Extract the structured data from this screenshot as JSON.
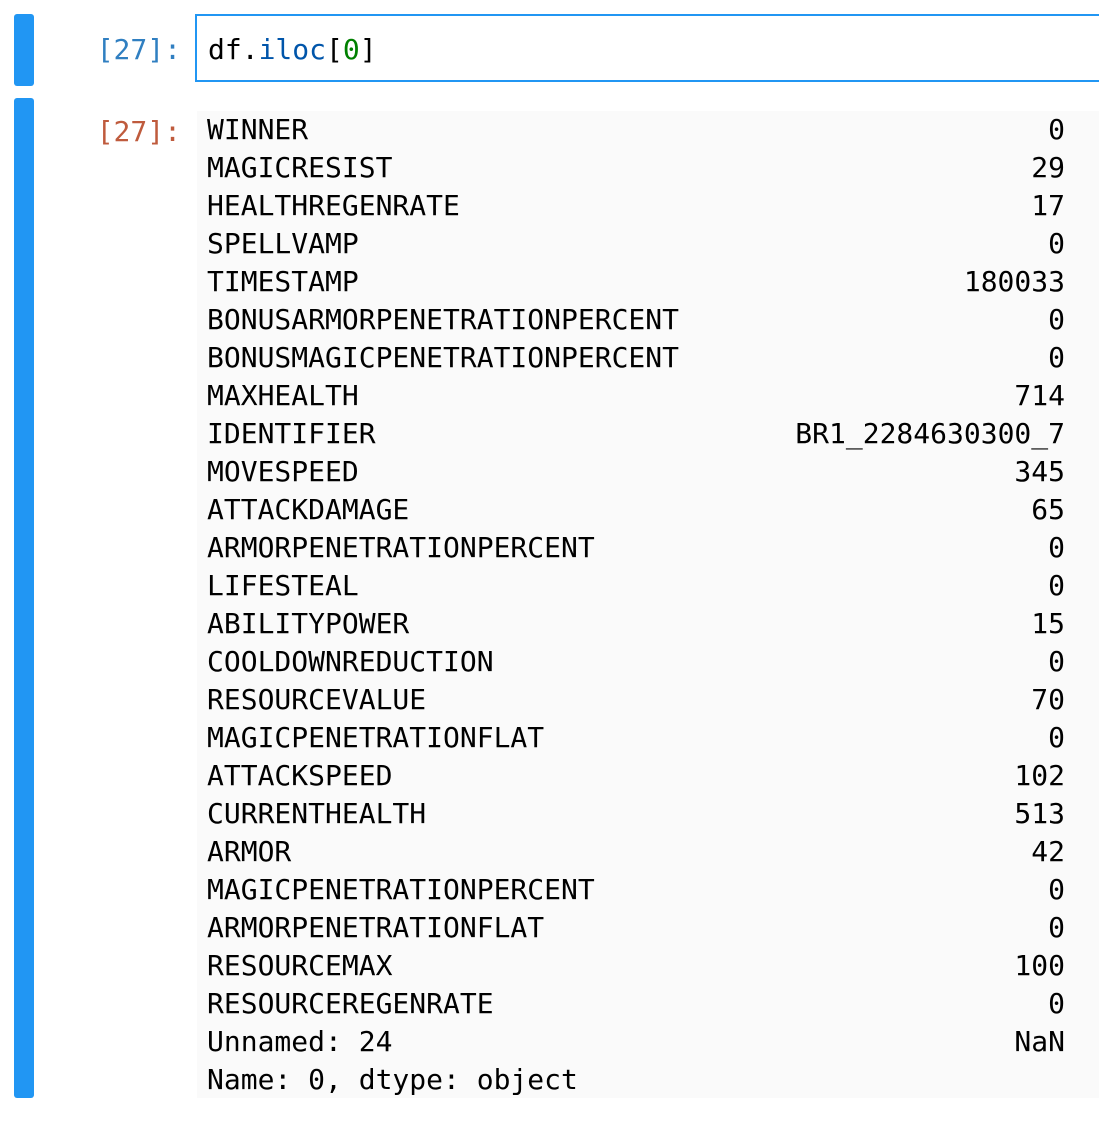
{
  "input_cell": {
    "prompt": "[27]:",
    "code": {
      "var": "df",
      "dot": ".",
      "method": "iloc",
      "open": "[",
      "index": "0",
      "close": "]"
    }
  },
  "output_cell": {
    "prompt": "[27]:",
    "rows": [
      {
        "key": "WINNER",
        "value": "0"
      },
      {
        "key": "MAGICRESIST",
        "value": "29"
      },
      {
        "key": "HEALTHREGENRATE",
        "value": "17"
      },
      {
        "key": "SPELLVAMP",
        "value": "0"
      },
      {
        "key": "TIMESTAMP",
        "value": "180033"
      },
      {
        "key": "BONUSARMORPENETRATIONPERCENT",
        "value": "0"
      },
      {
        "key": "BONUSMAGICPENETRATIONPERCENT",
        "value": "0"
      },
      {
        "key": "MAXHEALTH",
        "value": "714"
      },
      {
        "key": "IDENTIFIER",
        "value": "BR1_2284630300_7"
      },
      {
        "key": "MOVESPEED",
        "value": "345"
      },
      {
        "key": "ATTACKDAMAGE",
        "value": "65"
      },
      {
        "key": "ARMORPENETRATIONPERCENT",
        "value": "0"
      },
      {
        "key": "LIFESTEAL",
        "value": "0"
      },
      {
        "key": "ABILITYPOWER",
        "value": "15"
      },
      {
        "key": "COOLDOWNREDUCTION",
        "value": "0"
      },
      {
        "key": "RESOURCEVALUE",
        "value": "70"
      },
      {
        "key": "MAGICPENETRATIONFLAT",
        "value": "0"
      },
      {
        "key": "ATTACKSPEED",
        "value": "102"
      },
      {
        "key": "CURRENTHEALTH",
        "value": "513"
      },
      {
        "key": "ARMOR",
        "value": "42"
      },
      {
        "key": "MAGICPENETRATIONPERCENT",
        "value": "0"
      },
      {
        "key": "ARMORPENETRATIONFLAT",
        "value": "0"
      },
      {
        "key": "RESOURCEMAX",
        "value": "100"
      },
      {
        "key": "RESOURCEREGENRATE",
        "value": "0"
      },
      {
        "key": "Unnamed: 24",
        "value": "NaN"
      }
    ],
    "footer": "Name: 0, dtype: object"
  },
  "colors": {
    "accent": "#2196f3",
    "in_prompt": "#307fc1",
    "out_prompt": "#bf5b3d",
    "number_literal": "#008000",
    "property": "#0055aa",
    "output_bg": "#fafafa"
  }
}
